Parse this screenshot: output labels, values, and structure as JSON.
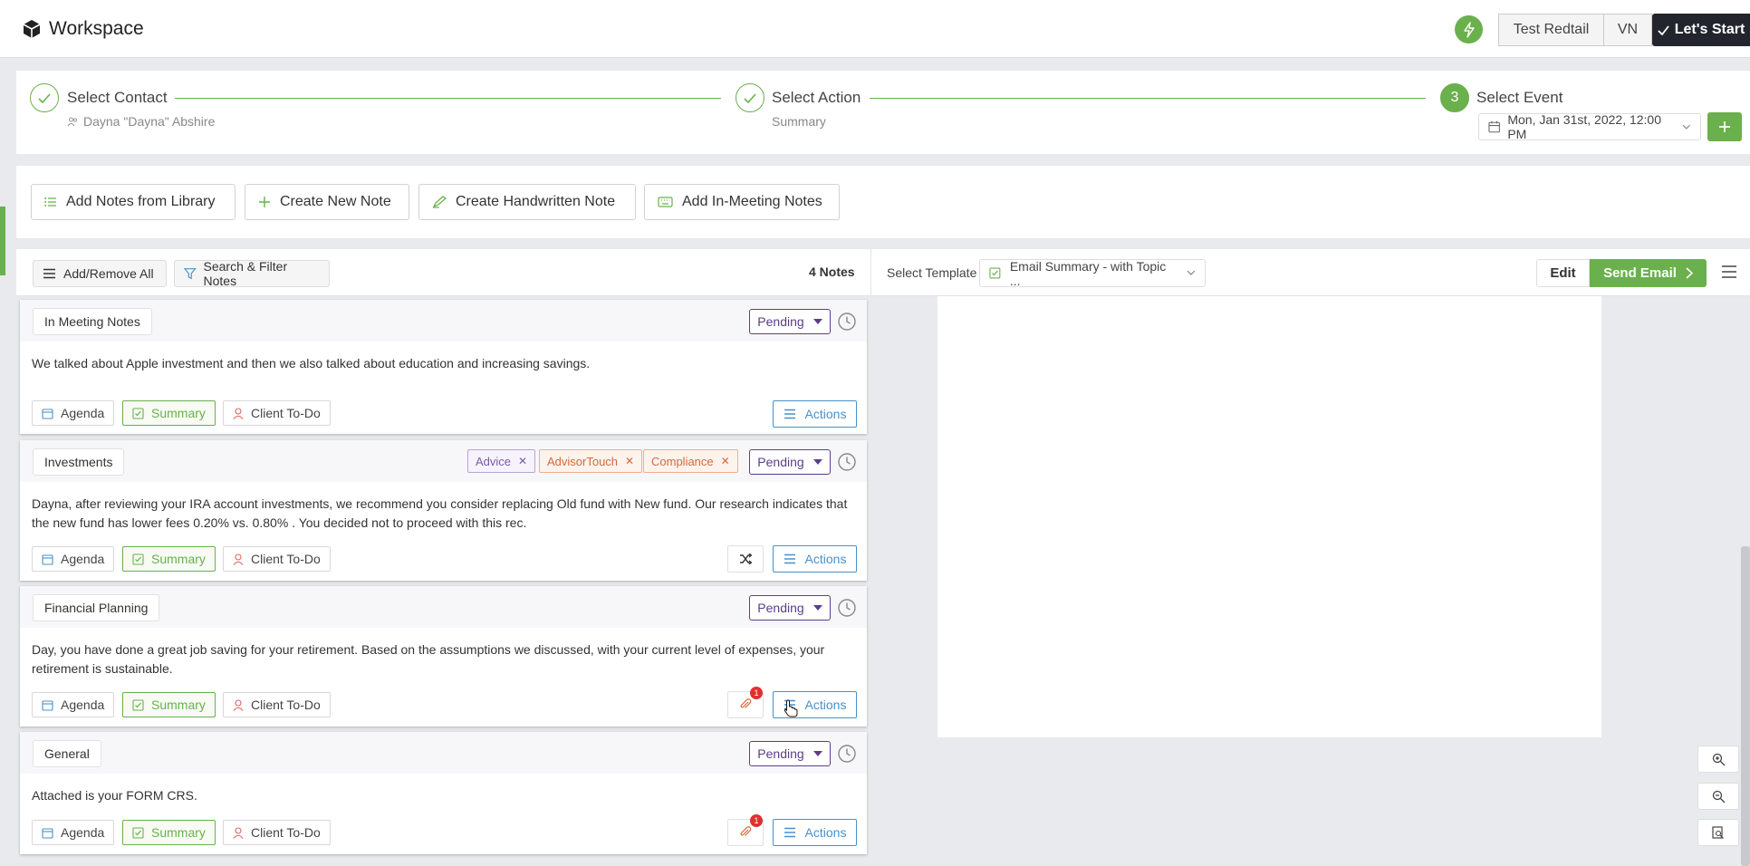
{
  "header": {
    "app_title": "Workspace",
    "user_name": "Test Redtail",
    "user_initials": "VN",
    "start_label": "Let's Start"
  },
  "stepper": {
    "step1": {
      "title": "Select Contact",
      "subtitle": "Dayna \"Dayna\" Abshire"
    },
    "step2": {
      "title": "Select Action",
      "subtitle": "Summary"
    },
    "step3": {
      "number": "3",
      "title": "Select Event",
      "date": "Mon, Jan 31st, 2022, 12:00 PM"
    }
  },
  "note_actions": {
    "library": "Add Notes from Library",
    "new_note": "Create New Note",
    "handwritten": "Create Handwritten Note",
    "in_meeting": "Add In-Meeting Notes"
  },
  "toolbar": {
    "add_remove": "Add/Remove All",
    "search_filter": "Search & Filter Notes",
    "count": "4 Notes",
    "template_label": "Select Template",
    "template_value": "Email Summary - with Topic ...",
    "edit": "Edit",
    "send": "Send Email"
  },
  "labels": {
    "pending": "Pending",
    "agenda": "Agenda",
    "summary": "Summary",
    "client_todo": "Client To-Do",
    "actions": "Actions"
  },
  "notes": [
    {
      "title": "In Meeting Notes",
      "body": "We talked about Apple investment and then we also talked about education and increasing savings."
    },
    {
      "title": "Investments",
      "tags": [
        "Advice",
        "AdvisorTouch",
        "Compliance"
      ],
      "body": "Dayna, after reviewing your IRA account investments, we recommend you consider replacing Old fund with New fund. Our research indicates that the new fund has lower fees 0.20% vs. 0.80% . You decided not to proceed with this rec."
    },
    {
      "title": "Financial Planning",
      "body": "Day, you have done a great job saving for your retirement. Based on the assumptions we discussed, with your current level of expenses, your retirement is sustainable.",
      "attachments": "1"
    },
    {
      "title": "General",
      "body": "Attached is your FORM CRS.",
      "attachments": "1"
    }
  ],
  "colors": {
    "brand_green": "#6ab04c",
    "pending_purple": "#5b3e8a",
    "actions_blue": "#4a90c8",
    "dark": "#23252e"
  }
}
